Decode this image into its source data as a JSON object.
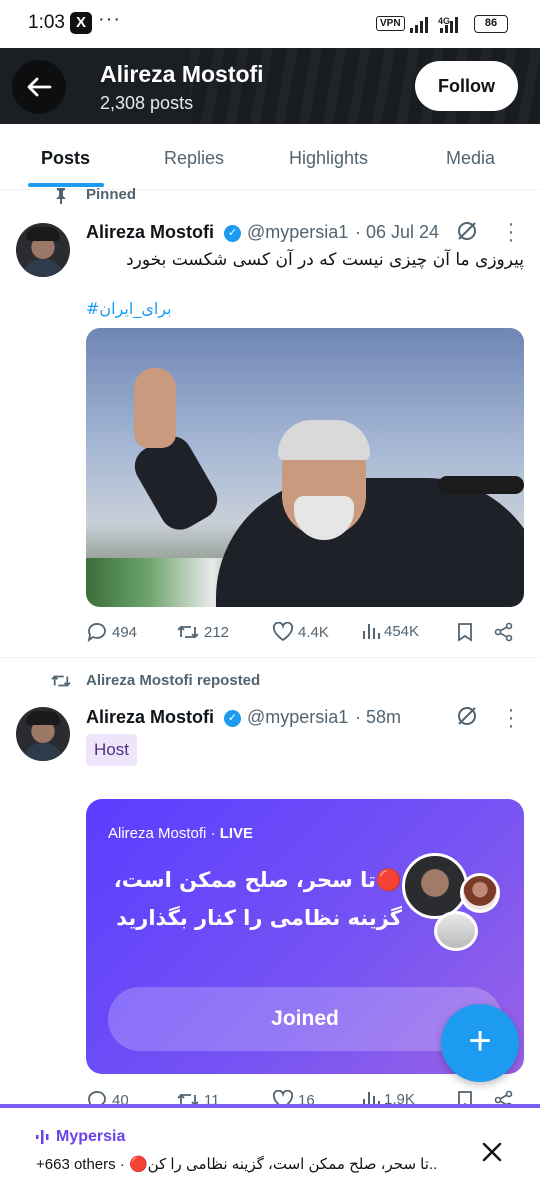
{
  "status_bar": {
    "time": "1:03",
    "app_icon": "X",
    "dots": "···",
    "vpn": "VPN",
    "network": "4G",
    "battery": "86"
  },
  "header": {
    "name": "Alireza Mostofi",
    "posts_count": "2,308 posts",
    "follow_label": "Follow"
  },
  "tabs": [
    {
      "label": "Posts",
      "active": true
    },
    {
      "label": "Replies",
      "active": false
    },
    {
      "label": "Highlights",
      "active": false
    },
    {
      "label": "Media",
      "active": false
    }
  ],
  "post1": {
    "pinned_label": "Pinned",
    "name": "Alireza Mostofi",
    "handle": "@mypersia1",
    "date": "· 06 Jul 24",
    "text": "پیروزی ما آن چیزی نیست که در آن کسی شکست بخورد",
    "hashtag": "#برای_ایران",
    "actions": {
      "replies": "494",
      "reposts": "212",
      "likes": "4.4K",
      "views": "454K"
    }
  },
  "post2": {
    "repost_label": "Alireza Mostofi reposted",
    "name": "Alireza Mostofi",
    "handle": "@mypersia1",
    "time": "· 58m",
    "badge": "Host",
    "live_card": {
      "host": "Alireza Mostofi",
      "live": "LIVE",
      "title": "🔴تا سحر، صلح ممکن است، گزینه نظامی را کنار بگذارید",
      "joined_label": "Joined"
    },
    "actions": {
      "replies": "40",
      "reposts": "11",
      "likes": "16",
      "views": "1.9K"
    }
  },
  "bottom_bar": {
    "title": "Mypersia",
    "subtitle": "+663 others · 🔴تا سحر، صلح ممکن است، گزینه نظامی را کن..."
  },
  "colors": {
    "accent": "#1d9bf0",
    "header_bg": "#1b1f23",
    "live_card": "#6a4cf6",
    "muted": "#536471"
  }
}
